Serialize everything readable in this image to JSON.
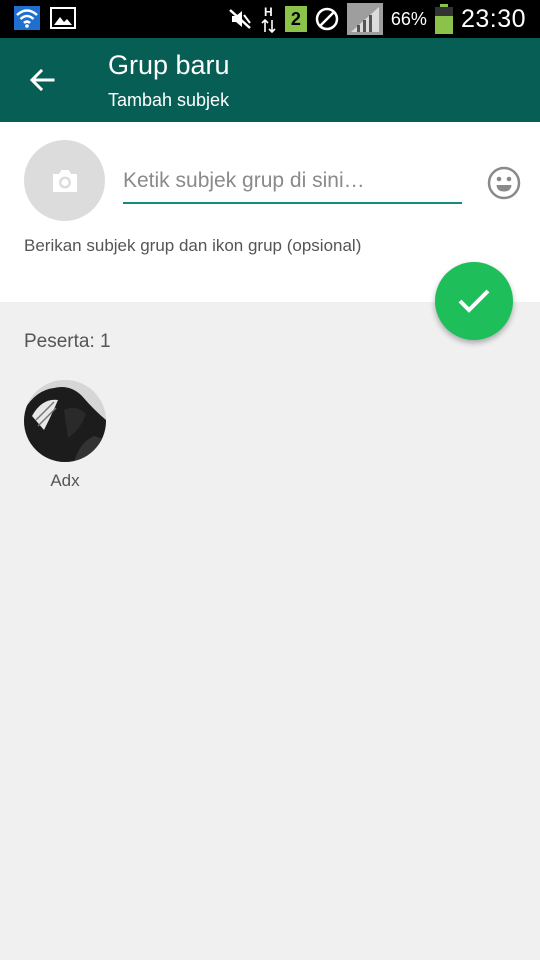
{
  "status_bar": {
    "battery_percent": "66%",
    "time": "23:30",
    "sim_badge": "2",
    "network_type": "H",
    "icons": [
      "wifi-icon",
      "gallery-icon",
      "mute-icon",
      "data-arrows-icon",
      "sim-icon",
      "block-icon",
      "signal-icon",
      "battery-icon"
    ]
  },
  "toolbar": {
    "title": "Grup baru",
    "subtitle": "Tambah subjek",
    "back_icon": "arrow-back-icon"
  },
  "subject": {
    "placeholder": "Ketik subjek grup di sini…",
    "value": "",
    "hint": "Berikan subjek grup dan ikon grup (opsional)",
    "photo_icon": "camera-icon",
    "emoji_icon": "emoji-icon"
  },
  "fab": {
    "icon": "check-icon"
  },
  "participants": {
    "count_label": "Peserta: 1",
    "items": [
      {
        "name": "Adx"
      }
    ]
  },
  "colors": {
    "toolbar": "#075e54",
    "accent": "#128c7e",
    "fab": "#1ebe5a",
    "background": "#f0f0f0"
  }
}
